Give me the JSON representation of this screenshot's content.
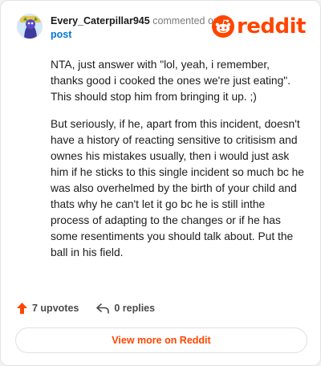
{
  "header": {
    "username": "Every_Caterpillar945",
    "action": "commented on",
    "target": "post",
    "logo_text": "reddit"
  },
  "comment": {
    "paragraphs": [
      "NTA, just answer with \"lol, yeah, i remember, thanks good i cooked the ones we're just eating\". This should stop him from bringing it up. ;)",
      "But seriously, if he, apart from this incident, doesn't have a history of reacting sensitive to critisism and ownes his mistakes usually, then i would just ask him if he sticks to this single incident so much bc he was also overhelmed by the birth of your child and thats why he can't let it go bc he is still inthe process of adapting to the changes or if he has some resentiments you should talk about. Put the ball in his field."
    ]
  },
  "footer": {
    "upvotes": "7 upvotes",
    "replies": "0 replies",
    "upvote_icon": "upvote-arrow-icon",
    "reply_icon": "reply-arrow-icon"
  },
  "view_button": "View more on Reddit",
  "colors": {
    "brand": "#ff4500",
    "link": "#0079d3",
    "muted": "#7c7c7c"
  }
}
